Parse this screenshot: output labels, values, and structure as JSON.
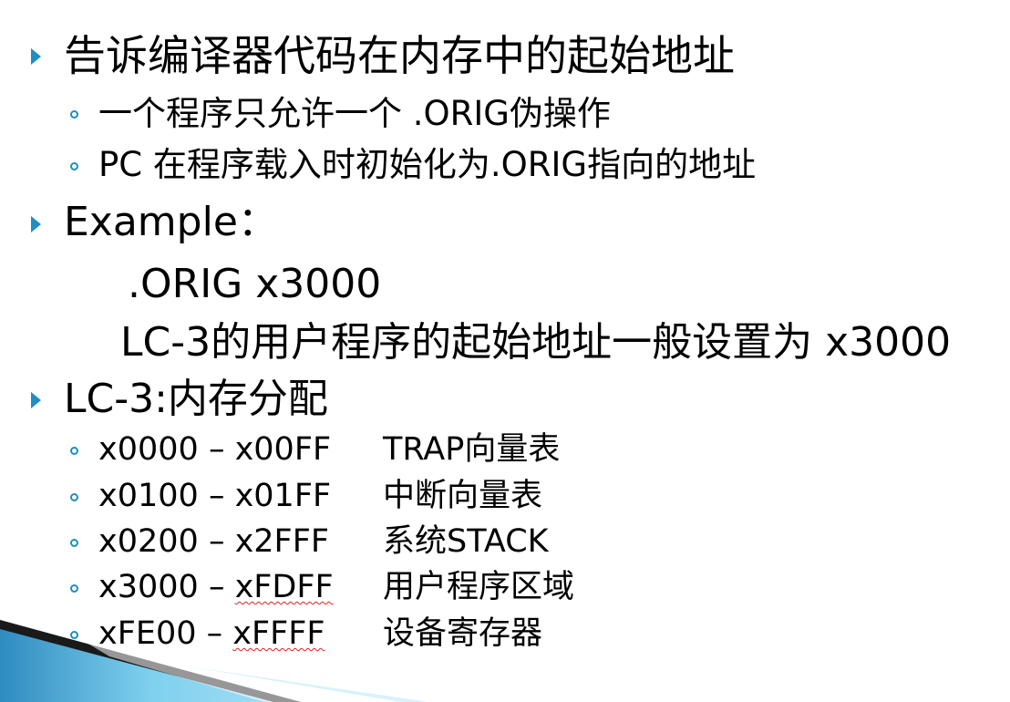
{
  "slide": {
    "bullets": [
      {
        "text": "告诉编译器代码在内存中的起始地址",
        "sub": [
          "一个程序只允许一个 .ORIG伪操作",
          "PC 在程序载入时初始化为.ORIG指向的地址"
        ]
      },
      {
        "text": "Example：",
        "code_lines": [
          ".ORIG x3000",
          "LC-3的用户程序的起始地址一般设置为 x3000"
        ]
      },
      {
        "text": "LC-3:内存分配",
        "memory_map": [
          {
            "from": "x0000",
            "sep": "–",
            "to": "x00FF",
            "desc": "TRAP向量表"
          },
          {
            "from": "x0100",
            "sep": "–",
            "to": "x01FF",
            "desc": "中断向量表"
          },
          {
            "from": "x0200",
            "sep": "–",
            "to": "x2FFF",
            "desc": "系统STACK"
          },
          {
            "from": "x3000",
            "sep": "–",
            "to": "xFDFF",
            "desc": "用户程序区域"
          },
          {
            "from": "xFE00",
            "sep": "–",
            "to": "xFFFF",
            "desc": "设备寄存器"
          }
        ]
      }
    ],
    "colors": {
      "bullet": "#1e8ec4",
      "corner_light": "#7fd0ee",
      "corner_dark": "#2a6f9a",
      "text": "#000000",
      "spellcheck": "#e02020"
    }
  }
}
